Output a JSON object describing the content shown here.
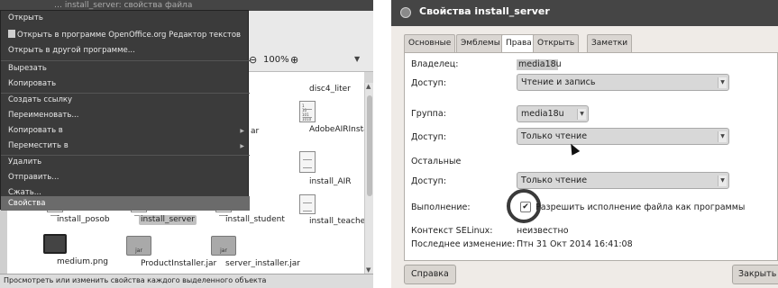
{
  "file_manager": {
    "title_ghost": "… install_server: свойства файла",
    "zoom": {
      "value": "100%"
    },
    "files": [
      {
        "label": "disc4_liter",
        "icon": "doc",
        "selected": false
      },
      {
        "label": "AdobeAIRInstaller.bin",
        "icon": "doc",
        "selected": false
      },
      {
        "label": "ar",
        "icon": "doc",
        "selected": false
      },
      {
        "label": "install_AIR",
        "icon": "doc",
        "selected": false
      },
      {
        "label": "install_posob",
        "icon": "doc",
        "selected": false
      },
      {
        "label": "install_server",
        "icon": "doc",
        "selected": true
      },
      {
        "label": "install_student",
        "icon": "doc",
        "selected": false
      },
      {
        "label": "install_teacher",
        "icon": "doc",
        "selected": false
      },
      {
        "label": "medium.png",
        "icon": "image",
        "selected": false
      },
      {
        "label": "ProductInstaller.jar",
        "icon": "jar",
        "selected": false
      },
      {
        "label": "server_installer.jar",
        "icon": "jar",
        "selected": false
      }
    ],
    "jar_label": "jar",
    "doc_lines": [
      "1",
      "10",
      "101",
      "1010"
    ],
    "status": "Просмотреть или изменить свойства каждого выделенного объекта"
  },
  "context_menu": {
    "items": [
      {
        "label": "Открыть"
      },
      {
        "label": "Открыть в программе OpenOffice.org Редактор текстов",
        "icon": "document-icon"
      },
      {
        "label": "Открыть в другой программе..."
      },
      {
        "label": "Вырезать"
      },
      {
        "label": "Копировать"
      },
      {
        "label": "Создать ссылку"
      },
      {
        "label": "Переименовать..."
      },
      {
        "label": "Копировать в",
        "submenu": true
      },
      {
        "label": "Переместить в",
        "submenu": true
      },
      {
        "label": "Удалить"
      },
      {
        "label": "Отправить..."
      },
      {
        "label": "Сжать..."
      },
      {
        "label": "Свойства",
        "highlighted": true
      }
    ]
  },
  "properties_dialog": {
    "title": "Свойства install_server",
    "tabs": [
      "Основные",
      "Эмблемы",
      "Права",
      "Открыть в",
      "Заметки"
    ],
    "active_tab": "Права",
    "owner": {
      "label": "Владелец:",
      "value": "media18u"
    },
    "owner_access": {
      "label": "Доступ:",
      "value": "Чтение и запись"
    },
    "group": {
      "label": "Группа:",
      "value": "media18u"
    },
    "group_access": {
      "label": "Доступ:",
      "value": "Только чтение"
    },
    "others": {
      "label": "Остальные"
    },
    "others_access": {
      "label": "Доступ:",
      "value": "Только чтение"
    },
    "execute": {
      "label": "Выполнение:",
      "checkbox_label": "Разрешить исполнение файла как программы",
      "checked": true
    },
    "selinux": {
      "label": "Контекст SELinux:",
      "value": "неизвестно"
    },
    "modified": {
      "label": "Последнее изменение:",
      "value": "Птн 31 Окт 2014 16:41:08"
    },
    "help_button": "Справка",
    "close_button": "Закрыть"
  },
  "colors": {
    "menu_bg": "#3b3b3b",
    "menu_highlight": "#6b6b6b",
    "titlebar": "#454545",
    "dialog_bg": "#efebe7"
  }
}
